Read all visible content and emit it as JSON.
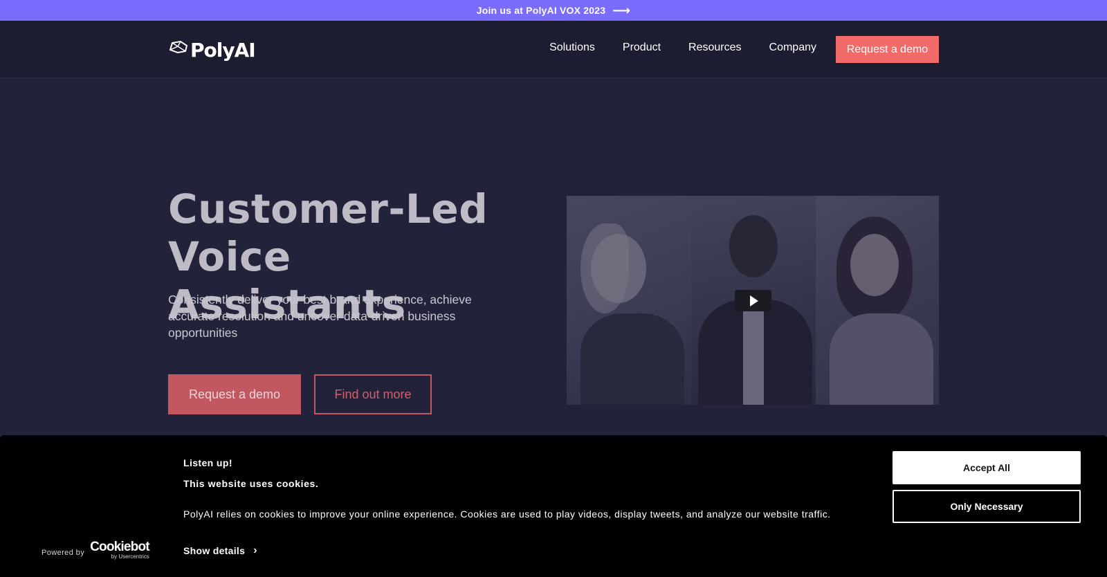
{
  "announcement": {
    "text": "Join us at PolyAI VOX 2023",
    "arrow_icon": "arrow-right-icon"
  },
  "header": {
    "logo_text": "PolyAI",
    "nav": [
      "Solutions",
      "Product",
      "Resources",
      "Company"
    ],
    "cta_label": "Request a demo"
  },
  "hero": {
    "title_line1": "Customer-Led",
    "title_line2": "Voice Assistants",
    "subtitle": "Consistently deliver your best brand experience, achieve accurate resolution and uncover data-driven business opportunities",
    "primary_button": "Request a demo",
    "secondary_button": "Find out more"
  },
  "video": {
    "play_icon": "play-icon"
  },
  "cookie_banner": {
    "heading": "Listen up!",
    "subheading": "This website uses cookies.",
    "body": "PolyAI relies on cookies to improve your online experience. Cookies are used to play videos, display tweets, and analyze our website traffic.",
    "details_label": "Show details",
    "accept_label": "Accept All",
    "necessary_label": "Only Necessary",
    "powered_by": "Powered by",
    "brand": "Cookiebot",
    "brand_sub": "by Usercentrics"
  },
  "colors": {
    "announcement_bg": "#7a6cff",
    "nav_bg": "#1d1d31",
    "page_bg": "#22223a",
    "accent": "#f26b6b",
    "cookie_bg": "#000000"
  }
}
